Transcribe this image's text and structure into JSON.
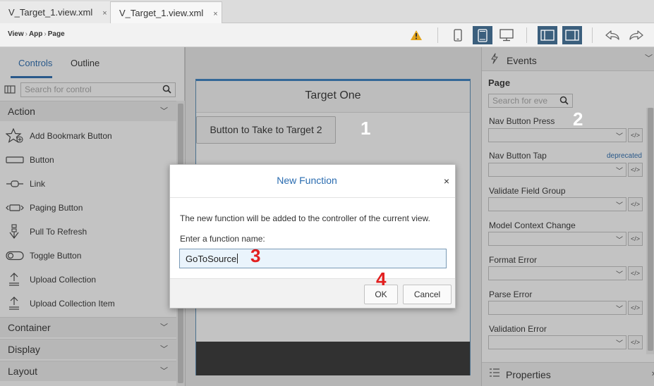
{
  "tabs": [
    {
      "label": "V_Target_1.view.xml",
      "close": "×"
    },
    {
      "label": "V_Target_1.view.xml",
      "close": "×"
    }
  ],
  "toolbar": {
    "breadcrumb": [
      "View",
      "App",
      "Page"
    ],
    "breadcrumb_sep": "›",
    "icons": [
      "warning-icon",
      "phone-icon",
      "tablet-icon",
      "desktop-icon",
      "left-panel-icon",
      "right-panel-icon",
      "undo-icon",
      "redo-icon"
    ],
    "accent": "#3b5f7d"
  },
  "left_panel": {
    "tabs": [
      "Controls",
      "Outline"
    ],
    "search_placeholder": "Search for control",
    "categories": {
      "action": "Action",
      "container": "Container",
      "display": "Display",
      "layout": "Layout"
    },
    "controls": [
      {
        "label": "Add Bookmark Button",
        "icon": "star-add-icon"
      },
      {
        "label": "Button",
        "icon": "button-icon"
      },
      {
        "label": "Link",
        "icon": "link-icon"
      },
      {
        "label": "Paging Button",
        "icon": "paging-button-icon"
      },
      {
        "label": "Pull To Refresh",
        "icon": "pull-refresh-icon"
      },
      {
        "label": "Toggle Button",
        "icon": "toggle-icon"
      },
      {
        "label": "Upload Collection",
        "icon": "upload-icon"
      },
      {
        "label": "Upload Collection Item",
        "icon": "upload-item-icon"
      }
    ]
  },
  "canvas": {
    "page_title": "Target One",
    "button_label": "Button to Take to Target 2"
  },
  "right_panel": {
    "header": "Events",
    "section": "Page",
    "search_placeholder": "Search for eve",
    "events": [
      {
        "label": "Nav Button Press",
        "note": ""
      },
      {
        "label": "Nav Button Tap",
        "note": "deprecated"
      },
      {
        "label": "Validate Field Group",
        "note": ""
      },
      {
        "label": "Model Context Change",
        "note": ""
      },
      {
        "label": "Format Error",
        "note": ""
      },
      {
        "label": "Parse Error",
        "note": ""
      },
      {
        "label": "Validation Error",
        "note": ""
      }
    ],
    "code_label": "</>",
    "properties_header": "Properties"
  },
  "dialog": {
    "title": "New Function",
    "close": "×",
    "message": "The new function will be added to the controller of the current view.",
    "field_label": "Enter a function name:",
    "field_value": "GoToSource",
    "ok": "OK",
    "cancel": "Cancel"
  },
  "annotations": [
    "1",
    "2",
    "3",
    "4"
  ]
}
